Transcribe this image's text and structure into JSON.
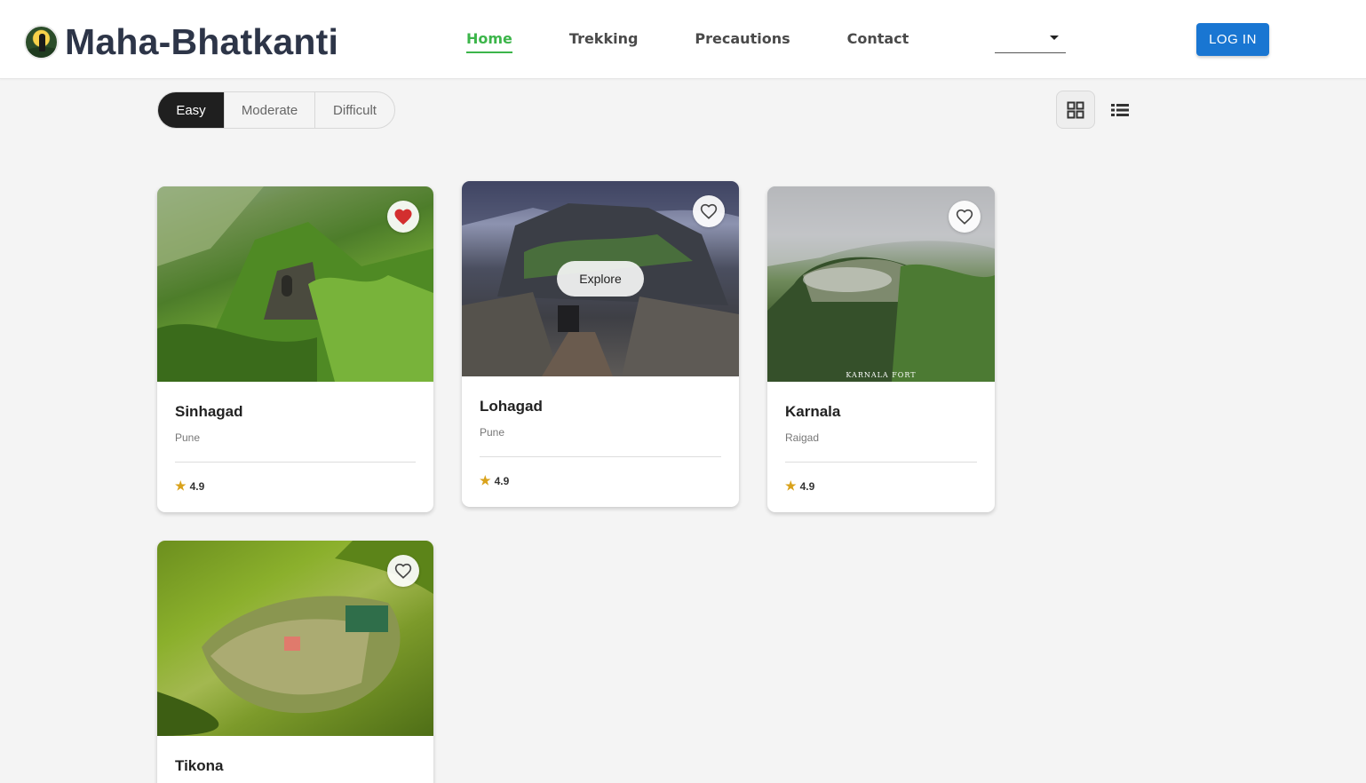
{
  "header": {
    "brand": "Maha-Bhatkanti",
    "nav": [
      {
        "label": "Home",
        "active": true
      },
      {
        "label": "Trekking",
        "active": false
      },
      {
        "label": "Precautions",
        "active": false
      },
      {
        "label": "Contact",
        "active": false
      }
    ],
    "select_value": "",
    "login_label": "LOG IN",
    "accent_color": "#3cb54a",
    "login_color": "#1976d2"
  },
  "filters": {
    "options": [
      "Easy",
      "Moderate",
      "Difficult"
    ],
    "selected": "Easy"
  },
  "view": {
    "grid_icon": "grid-view-icon",
    "list_icon": "list-view-icon",
    "selected": "grid"
  },
  "cards": [
    {
      "name": "Sinhagad",
      "location": "Pune",
      "rating": "4.9",
      "favorited": true
    },
    {
      "name": "Lohagad",
      "location": "Pune",
      "rating": "4.9",
      "favorited": false,
      "overlay": "Explore"
    },
    {
      "name": "Karnala",
      "location": "Raigad",
      "rating": "4.9",
      "favorited": false,
      "image_caption": "KARNALA FORT"
    },
    {
      "name": "Tikona",
      "location": "",
      "rating": "",
      "favorited": false
    }
  ]
}
